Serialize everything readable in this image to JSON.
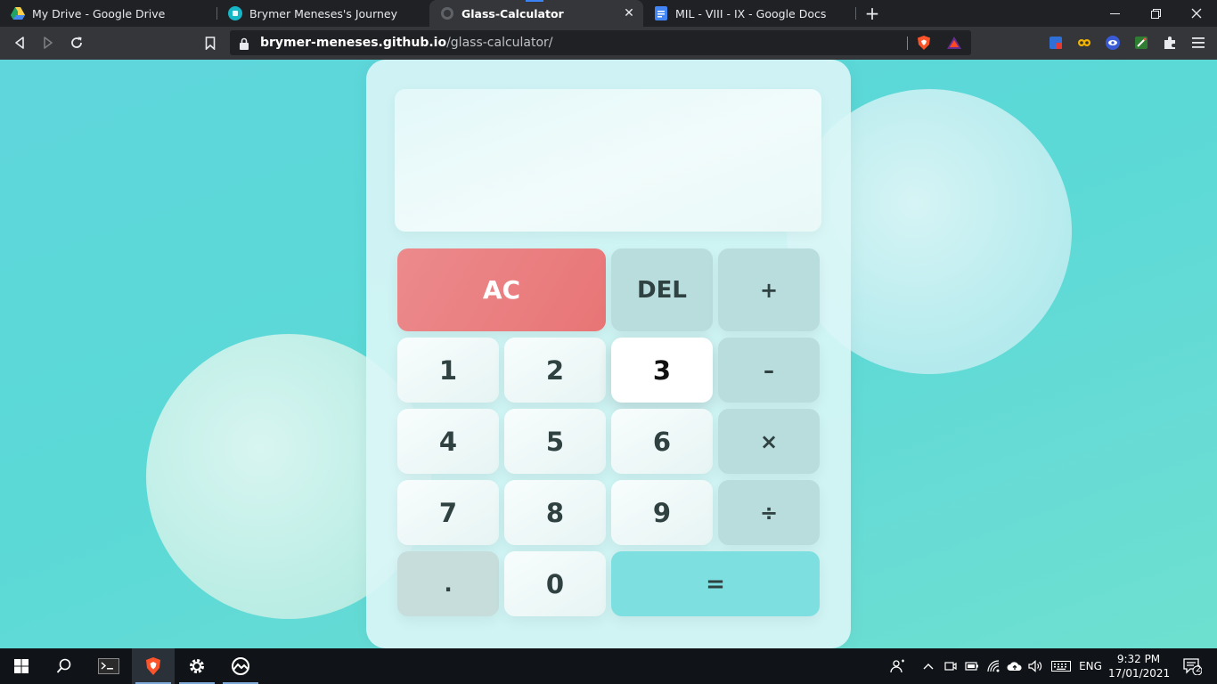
{
  "browser": {
    "tabs": [
      {
        "title": "My Drive - Google Drive",
        "icon": "google-drive-icon"
      },
      {
        "title": "Brymer Meneses's Journey",
        "icon": "site-icon"
      },
      {
        "title": "Glass-Calculator",
        "icon": "globe-icon",
        "active": true,
        "close": "✕"
      },
      {
        "title": "MIL - VIII - IX - Google Docs",
        "icon": "google-docs-icon"
      }
    ],
    "new_tab": "+",
    "window_controls": {
      "minimize": "—",
      "restore": "❐",
      "close": "✕"
    },
    "url_host": "brymer-meneses.github.io",
    "url_path": "/glass-calculator/",
    "extensions": [
      "shield-ext-icon",
      "owl-ext-icon",
      "eye-ext-icon",
      "pen-ext-icon",
      "puzzle-icon",
      "menu-icon"
    ]
  },
  "calculator": {
    "display_value": "",
    "keys": {
      "ac": "AC",
      "del": "DEL",
      "plus": "+",
      "one": "1",
      "two": "2",
      "three": "3",
      "minus": "–",
      "four": "4",
      "five": "5",
      "six": "6",
      "times": "×",
      "seven": "7",
      "eight": "8",
      "nine": "9",
      "divide": "÷",
      "dot": ".",
      "zero": "0",
      "equals": "="
    },
    "focused_key": "3"
  },
  "taskbar": {
    "language": "ENG",
    "time": "9:32 PM",
    "date": "17/01/2021",
    "notification_count": "2"
  },
  "colors": {
    "background": "#5fd6dc",
    "ac_key": "#e87576",
    "equals_key": "#7edfe0",
    "operator_key": "#b9dcdd"
  }
}
